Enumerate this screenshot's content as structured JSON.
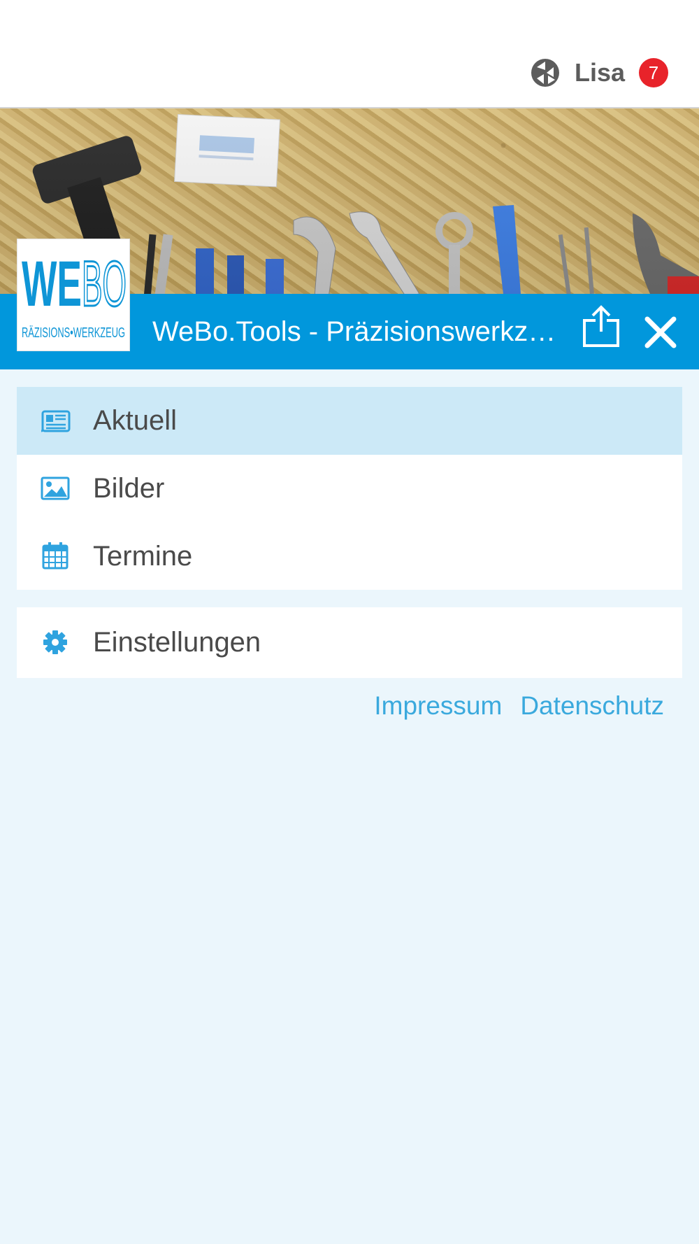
{
  "topbar": {
    "user_name": "Lisa",
    "notification_count": "7",
    "user_icon": "network-globe-icon"
  },
  "header": {
    "title": "WeBo.Tools - Präzisionswerkzeug",
    "logo_text": "WEBO",
    "logo_subtext": "RÄZISIONS•WERKZEUG",
    "share_icon": "share-icon",
    "close_icon": "close-icon"
  },
  "menu": {
    "items": [
      {
        "label": "Aktuell",
        "icon": "newspaper-icon",
        "active": true
      },
      {
        "label": "Bilder",
        "icon": "image-icon",
        "active": false
      },
      {
        "label": "Termine",
        "icon": "calendar-icon",
        "active": false
      }
    ],
    "settings": {
      "label": "Einstellungen",
      "icon": "gear-icon"
    }
  },
  "footer_links": {
    "impressum": "Impressum",
    "datenschutz": "Datenschutz"
  },
  "colors": {
    "accent": "#0197dc",
    "active_row": "#cce9f7",
    "background": "#ebf6fc",
    "badge": "#e8232a",
    "link": "#3aa9dd"
  }
}
